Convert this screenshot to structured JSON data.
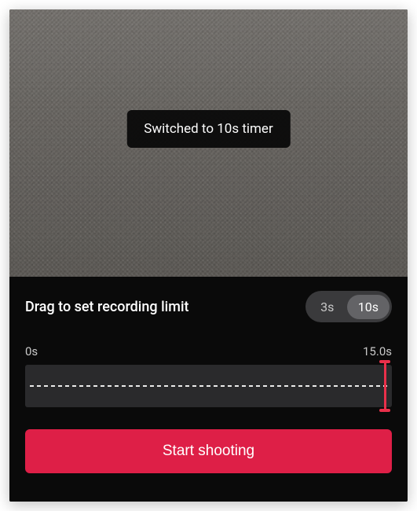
{
  "toast": {
    "message": "Switched to 10s timer"
  },
  "panel": {
    "drag_label": "Drag to set recording limit",
    "segment": {
      "option_a": "3s",
      "option_b": "10s",
      "active": "b"
    },
    "timeline": {
      "start_label": "0s",
      "end_label": "15.0s"
    },
    "start_button": "Start shooting"
  },
  "colors": {
    "accent": "#de1f47",
    "handle": "#e9304a"
  }
}
